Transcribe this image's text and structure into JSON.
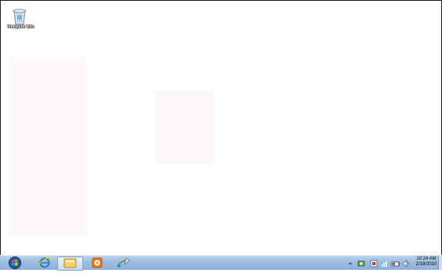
{
  "desktop": {
    "icons": [
      {
        "label": "Recycle Bin",
        "icon": "recycle-bin-icon"
      }
    ]
  },
  "taskbar": {
    "start": {
      "icon": "windows-orb-icon"
    },
    "pinned": [
      {
        "icon": "internet-explorer-icon",
        "active": false
      },
      {
        "icon": "windows-explorer-icon",
        "active": true
      },
      {
        "icon": "media-player-icon",
        "active": false
      },
      {
        "icon": "paint-icon",
        "active": false
      }
    ],
    "tray": {
      "icons": [
        "show-hidden-icons-chevron",
        "network-icon",
        "action-center-icon",
        "wifi-icon",
        "battery-icon",
        "volume-icon"
      ],
      "time": "10:24 AM",
      "date": "2/19/2010"
    }
  },
  "colors": {
    "taskbar_top": "#b7d1ec",
    "taskbar_bottom": "#8eb0d8"
  }
}
